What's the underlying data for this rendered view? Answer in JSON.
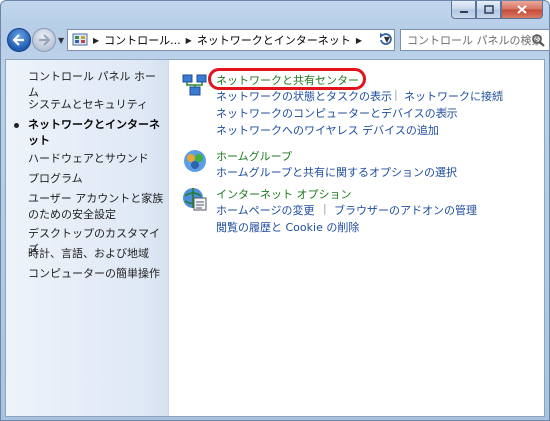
{
  "address_bar": {
    "crumbs": [
      "コントロール...",
      "ネットワークとインターネット"
    ]
  },
  "search": {
    "placeholder": "コントロール パネルの検索"
  },
  "sidebar": {
    "items": [
      {
        "label": "コントロール パネル ホーム"
      },
      {
        "label": "システムとセキュリティ"
      },
      {
        "label": "ネットワークとインターネット"
      },
      {
        "label": "ハードウェアとサウンド"
      },
      {
        "label": "プログラム"
      },
      {
        "label": "ユーザー アカウントと家族のための安全設定"
      },
      {
        "label": "デスクトップのカスタマイズ"
      },
      {
        "label": "時計、言語、および地域"
      },
      {
        "label": "コンピューターの簡単操作"
      }
    ]
  },
  "categories": [
    {
      "title": "ネットワークと共有センター",
      "icon": "network-sharing-icon",
      "links": [
        "ネットワークの状態とタスクの表示",
        "ネットワークに接続",
        "ネットワークのコンピューターとデバイスの表示",
        "ネットワークへのワイヤレス デバイスの追加"
      ]
    },
    {
      "title": "ホームグループ",
      "icon": "homegroup-icon",
      "links": [
        "ホームグループと共有に関するオプションの選択"
      ]
    },
    {
      "title": "インターネット オプション",
      "icon": "internet-options-icon",
      "links": [
        "ホームページの変更",
        "ブラウザーのアドオンの管理",
        "閲覧の履歴と Cookie の削除"
      ]
    }
  ],
  "colors": {
    "highlight": "#e0141a",
    "link": "#1e4ea0",
    "category": "#1e7a1e"
  }
}
